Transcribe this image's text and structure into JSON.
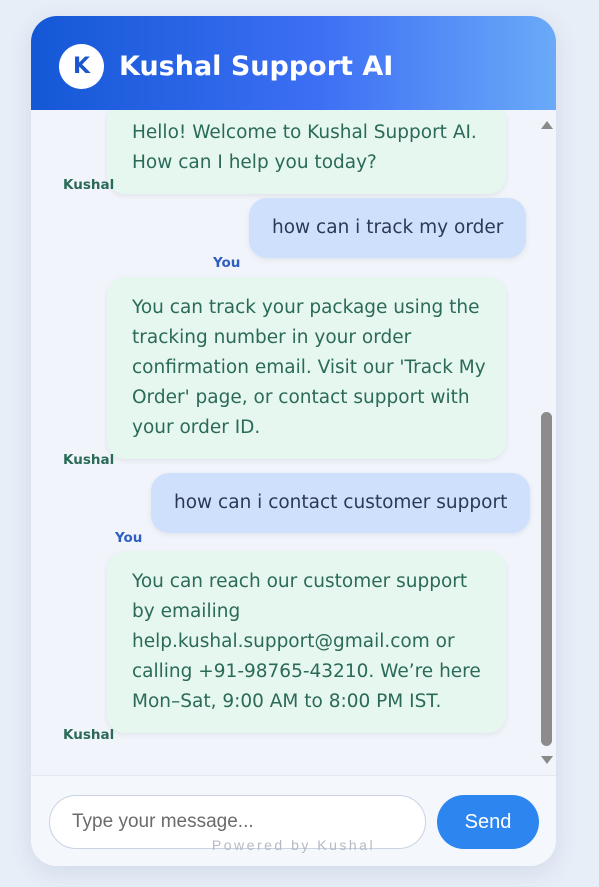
{
  "header": {
    "avatar_initial": "K",
    "title": "Kushal Support AI"
  },
  "messages": [
    {
      "sender": "Kushal",
      "text": "Hello! Welcome to Kushal Support AI. How can I help you today?"
    },
    {
      "sender": "You",
      "text": "how can i track my order"
    },
    {
      "sender": "Kushal",
      "text": "You can track your package using the tracking number in your order confirmation email. Visit our 'Track My Order' page, or contact support with your order ID."
    },
    {
      "sender": "You",
      "text": "how can i contact customer support"
    },
    {
      "sender": "Kushal",
      "text": "You can reach our customer support by emailing help.kushal.support@gmail.com or calling +91-98765-43210. We’re here Mon–Sat, 9:00 AM to 8:00 PM IST."
    }
  ],
  "input": {
    "placeholder": "Type your message...",
    "value": ""
  },
  "send_label": "Send",
  "footer": {
    "powered_by": "Powered by Kushal"
  },
  "colors": {
    "header_start": "#1458d6",
    "header_end": "#6aaaf8",
    "bot_bubble": "#e6f7ef",
    "user_bubble": "#cfe0fc",
    "send_button": "#2d86f0"
  },
  "icons": {
    "scroll_up": "triangle-up",
    "scroll_down": "triangle-down"
  }
}
